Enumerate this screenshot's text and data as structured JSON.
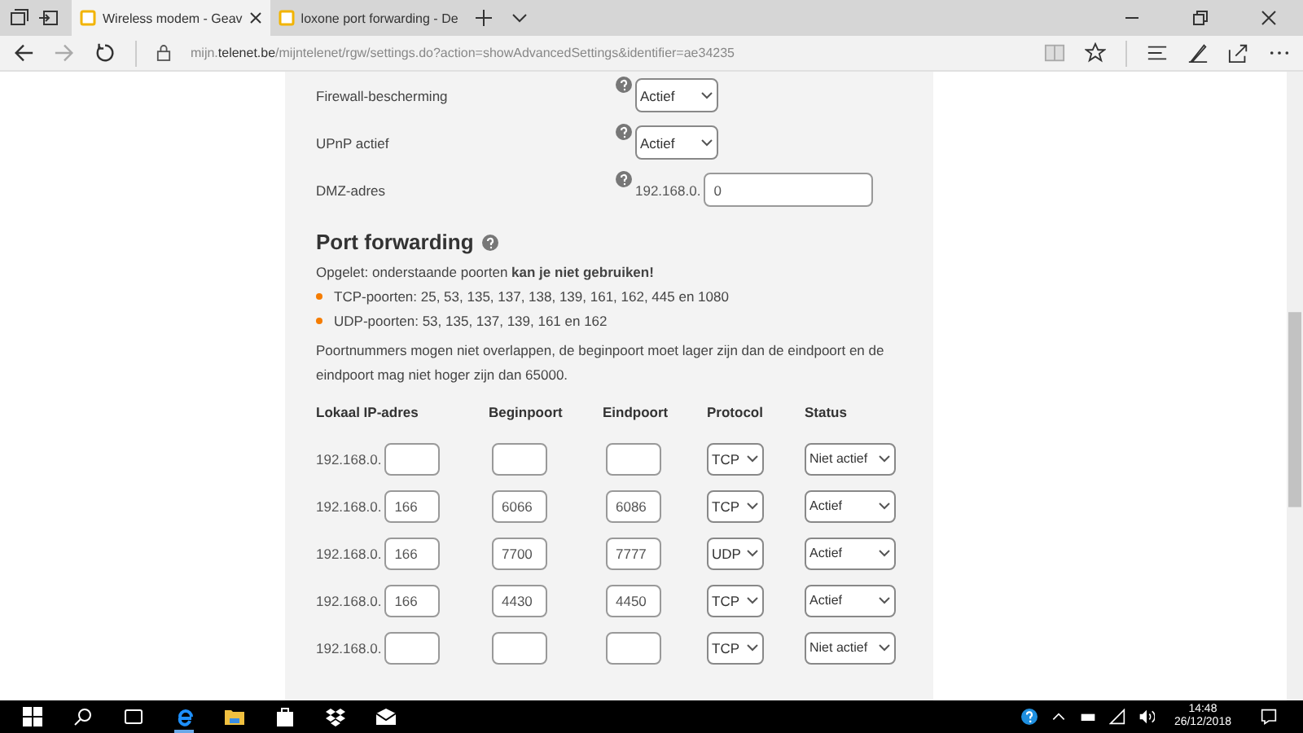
{
  "browser": {
    "tabs": [
      {
        "title": "Wireless modem - Geav",
        "selected": true
      },
      {
        "title": "loxone port forwarding - De",
        "selected": false
      }
    ],
    "url": "mijn.**telenet.be**/mijntelenet/rgw/settings.do?action=showAdvancedSettings&identifier=ae34235"
  },
  "settings": [
    {
      "label": "Firewall-bescherming",
      "kind": "select",
      "value": "Actief"
    },
    {
      "label": "UPnP actief",
      "kind": "select",
      "value": "Actief"
    },
    {
      "label": "DMZ-adres",
      "kind": "ip",
      "prefix": "192.168.0.",
      "value": "0"
    }
  ],
  "port_forwarding": {
    "title": "Port forwarding",
    "warning": "Opgelet: onderstaande poorten **kan je niet gebruiken!**",
    "bullets": [
      "TCP-poorten: 25, 53, 135, 137, 138, 139, 161, 162, 445 en 1080",
      "UDP-poorten: 53, 135, 137, 139, 161 en 162"
    ],
    "note": "Poortnummers mogen niet overlappen, de beginpoort moet lager zijn dan de eindpoort en de eindpoort mag niet hoger zijn dan 65000.",
    "columns": [
      "Lokaal IP-adres",
      "Beginpoort",
      "Eindpoort",
      "Protocol",
      "Status"
    ],
    "rows": [
      {
        "ip_prefix": "192.168.0.",
        "ip": "",
        "begin": "",
        "end": "",
        "protocol": "TCP",
        "status": "Niet actief"
      },
      {
        "ip_prefix": "192.168.0.",
        "ip": "166",
        "begin": "6066",
        "end": "6086",
        "protocol": "TCP",
        "status": "Actief"
      },
      {
        "ip_prefix": "192.168.0.",
        "ip": "166",
        "begin": "7700",
        "end": "7777",
        "protocol": "UDP",
        "status": "Actief"
      },
      {
        "ip_prefix": "192.168.0.",
        "ip": "166",
        "begin": "4430",
        "end": "4450",
        "protocol": "TCP",
        "status": "Actief"
      },
      {
        "ip_prefix": "192.168.0.",
        "ip": "",
        "begin": "",
        "end": "",
        "protocol": "TCP",
        "status": "Niet actief"
      }
    ]
  },
  "taskbar": {
    "time": "14:48",
    "date": "26/12/2018"
  }
}
